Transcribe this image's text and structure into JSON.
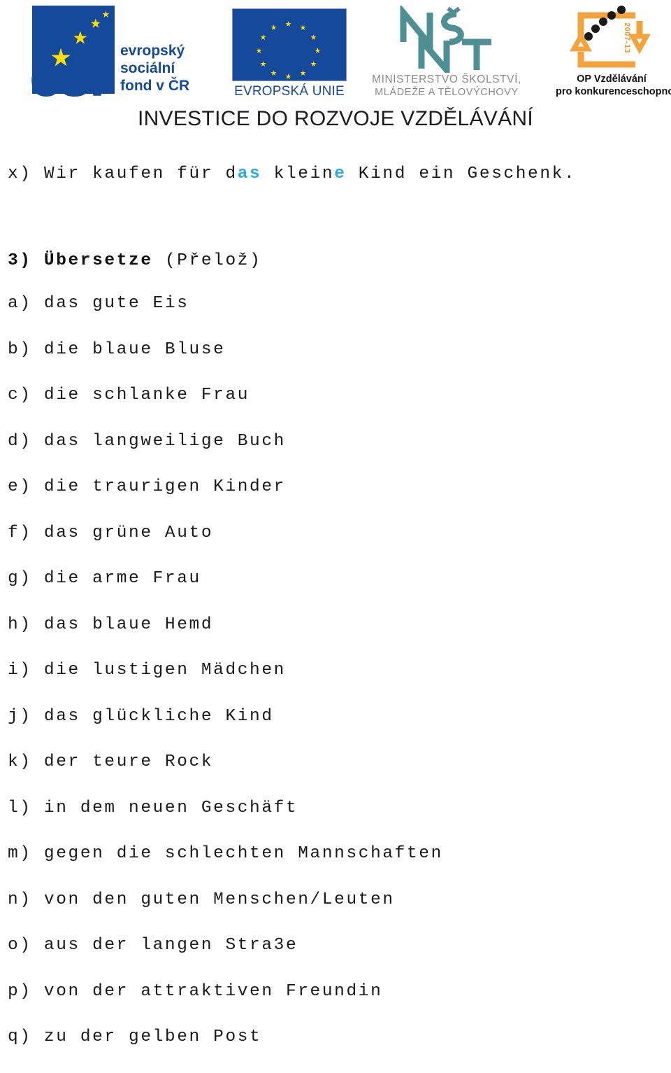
{
  "banner": {
    "esf": {
      "letters": "esf",
      "caption_lines": [
        "evropský",
        "sociální",
        "fond v ČR"
      ],
      "flag_color": "#14499b",
      "star_color": "#ffdd00",
      "text_color": "#14499b"
    },
    "eu": {
      "caption": "EVROPSKÁ UNIE",
      "flag_color": "#14499b",
      "star_color": "#ffdd00",
      "text_color": "#14499b"
    },
    "msmt": {
      "mark_letters": "MŠMT",
      "caption_lines": [
        "MINISTERSTVO ŠKOLSTVÍ,",
        "MLÁDEŽE A TĚLOVÝCHOVY"
      ],
      "mark_color": "#4d8f93",
      "text_color": "#8a8a8a"
    },
    "opvk": {
      "caption_lines": [
        "OP Vzdělávání",
        "pro konkurenceschopnost"
      ],
      "years": "2007-13",
      "mark_color": "#f2a33c",
      "dot_color": "#1a1a1a",
      "text_color": "#111111"
    },
    "slogan": "INVESTICE DO ROZVOJE VZDĚLÁVÁNÍ"
  },
  "content": {
    "intro": {
      "label": "x)",
      "part1": " Wir kaufen für d",
      "highlight1": "as",
      "part2": " klein",
      "highlight2": "e",
      "part3": " Kind ein Geschenk.",
      "highlight_color": "#29abe2"
    },
    "task": {
      "number": "3)",
      "verb": "Übersetze",
      "translation": "(Přelož)"
    },
    "items": [
      "a) das gute Eis",
      "b) die blaue Bluse",
      "c) die schlanke Frau",
      "d) das langweilige Buch",
      "e) die traurigen Kinder",
      "f) das grüne Auto",
      "g) die arme Frau",
      "h) das blaue Hemd",
      "i) die lustigen Mädchen",
      "j) das glückliche Kind",
      "k) der teure Rock",
      "l) in dem neuen Geschäft",
      "m) gegen die schlechten Mannschaften",
      "n) von den guten Menschen/Leuten",
      "o) aus der langen Stra3e",
      "p) von der attraktiven Freundin",
      "q) zu der gelben Post"
    ]
  }
}
